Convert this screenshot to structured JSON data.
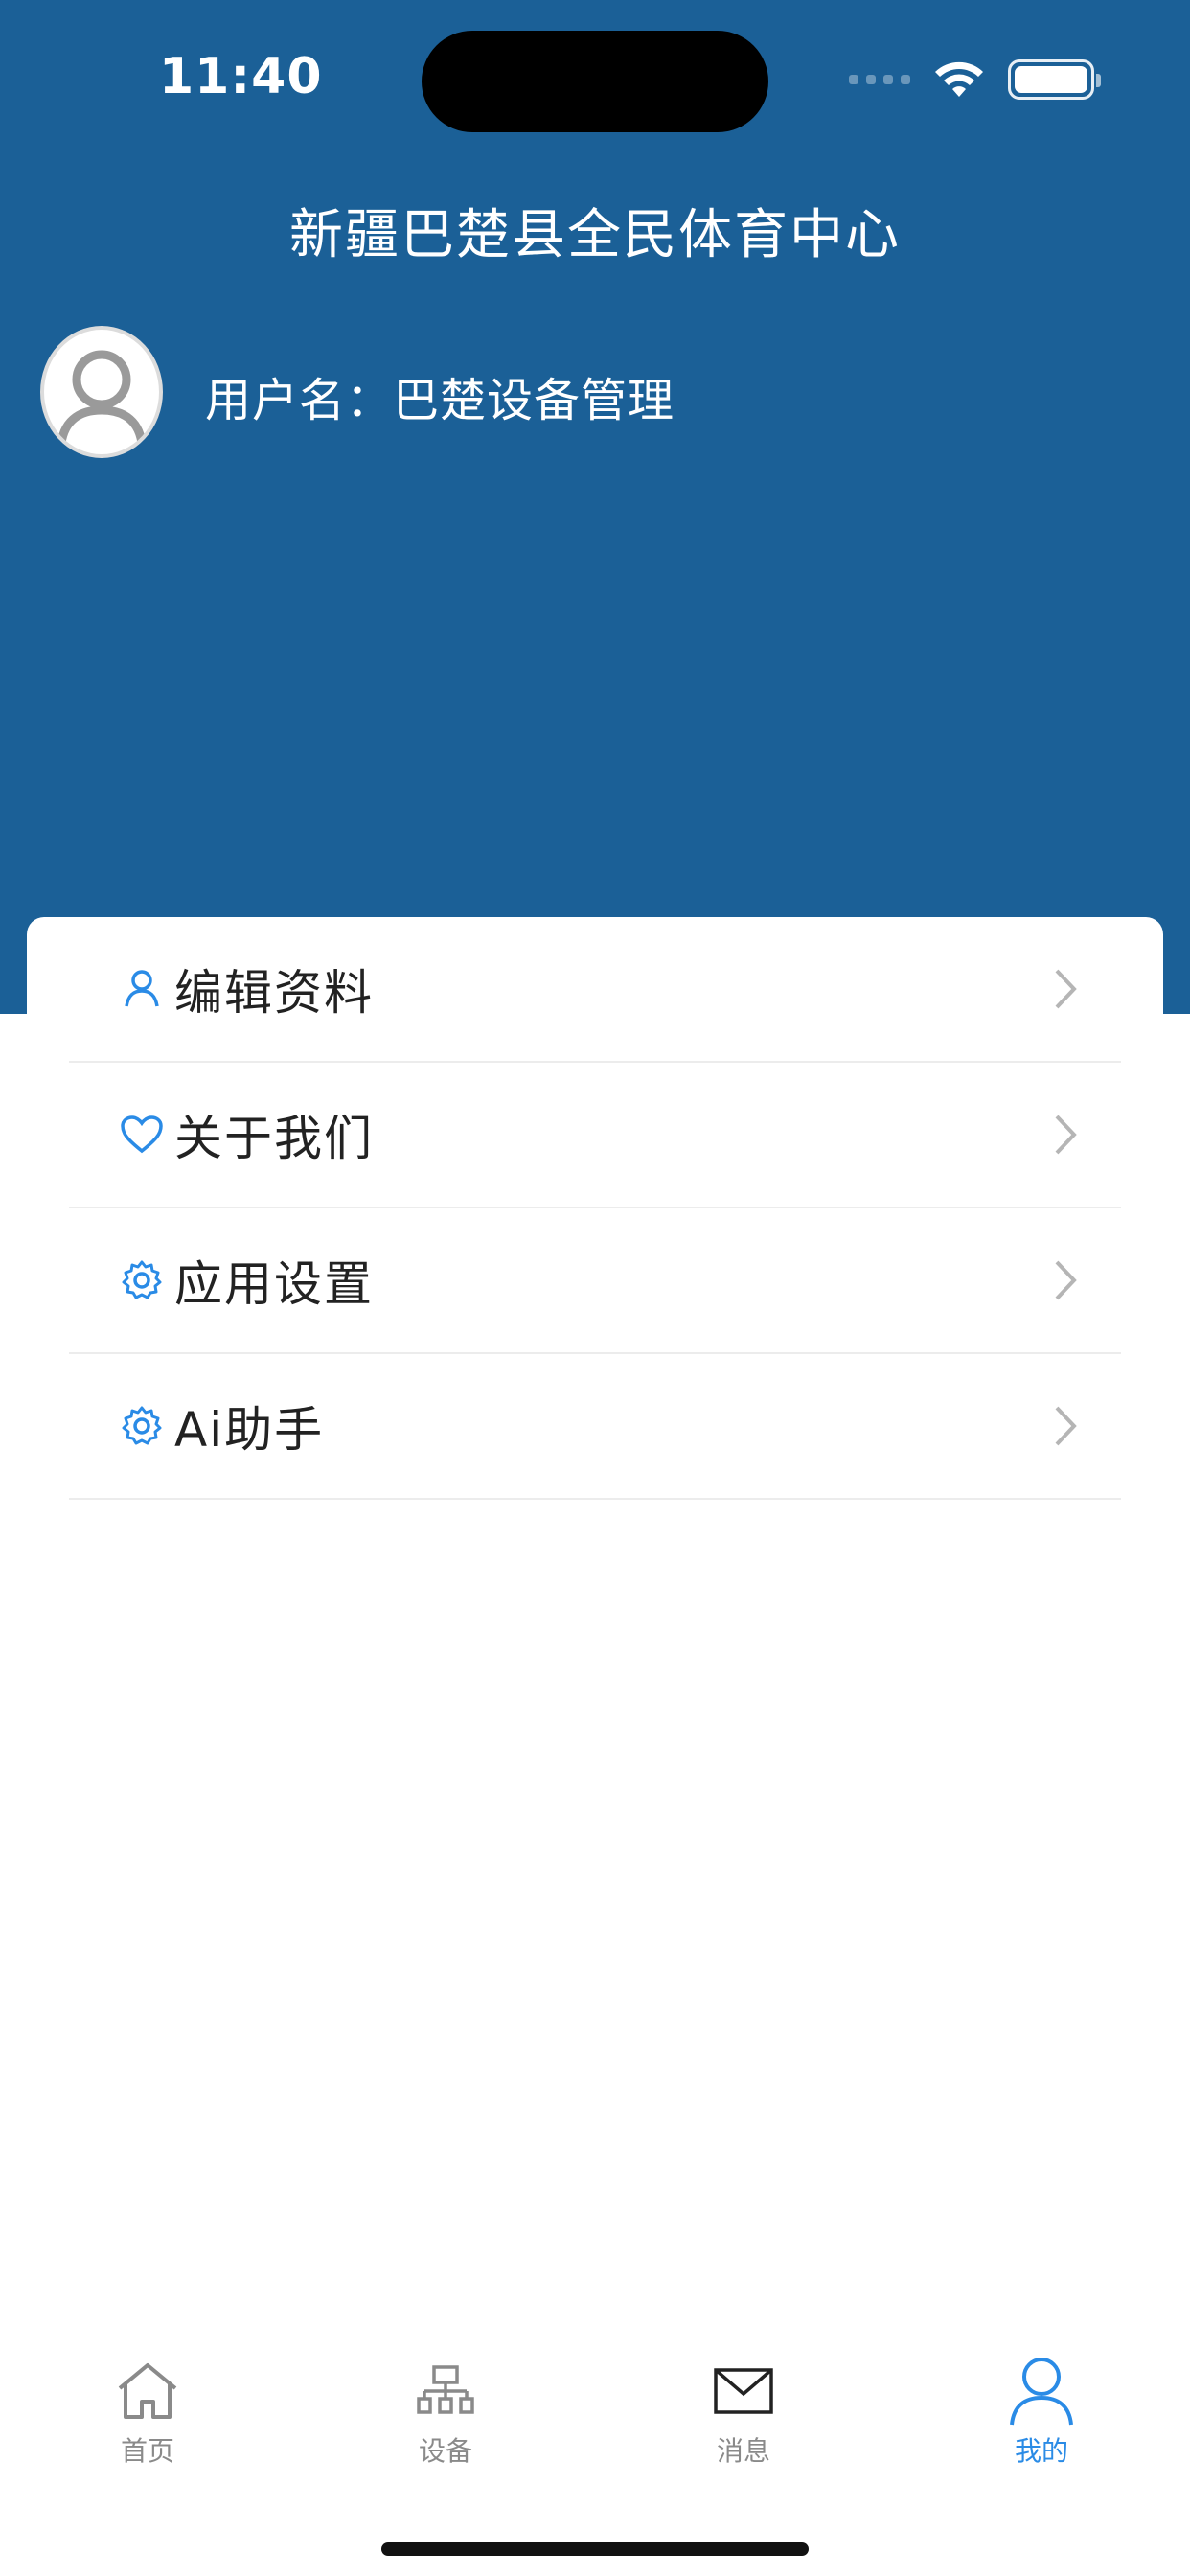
{
  "status_bar": {
    "time": "11:40"
  },
  "header": {
    "title": "新疆巴楚县全民体育中心",
    "username": "用户名：巴楚设备管理"
  },
  "menu": {
    "items": [
      {
        "label": "编辑资料",
        "icon": "user-icon"
      },
      {
        "label": "关于我们",
        "icon": "heart-icon"
      },
      {
        "label": "应用设置",
        "icon": "gear-icon"
      },
      {
        "label": "Ai助手",
        "icon": "gear-icon"
      }
    ]
  },
  "tabbar": {
    "items": [
      {
        "label": "首页",
        "icon": "home-icon",
        "active": false
      },
      {
        "label": "设备",
        "icon": "network-icon",
        "active": false
      },
      {
        "label": "消息",
        "icon": "mail-icon",
        "active": false
      },
      {
        "label": "我的",
        "icon": "user-icon",
        "active": true
      }
    ]
  },
  "colors": {
    "header_bg": "#1b6097",
    "accent": "#2a8be6",
    "inactive_tab": "#8a8a8a"
  }
}
